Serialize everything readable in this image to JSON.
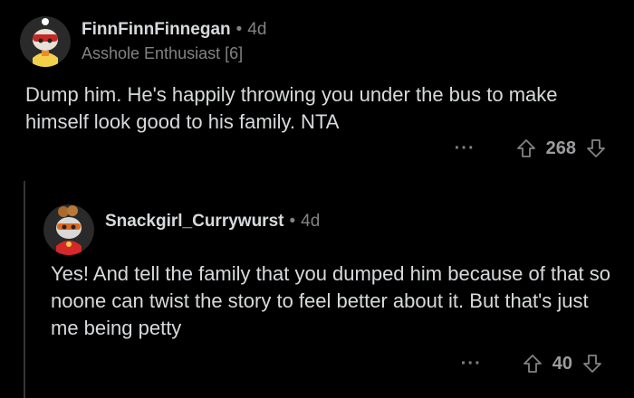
{
  "comments": [
    {
      "username": "FinnFinnFinnegan",
      "age": "4d",
      "flair": "Asshole Enthusiast [6]",
      "body": "Dump him. He's happily throwing you under the bus to make himself look good to his family. NTA",
      "more_label": "···",
      "score": "268"
    },
    {
      "username": "Snackgirl_Currywurst",
      "age": "4d",
      "body": "Yes! And tell the family that you dumped him because of that so noone can twist the story to feel better about it. But that's just me being petty",
      "more_label": "···",
      "score": "40"
    }
  ],
  "separator": "•",
  "icons": {
    "upvote": "upvote-arrow-icon",
    "downvote": "downvote-arrow-icon",
    "more": "more-options-icon"
  },
  "colors": {
    "background": "#000000",
    "text": "#d7dadc",
    "muted": "#818384"
  }
}
